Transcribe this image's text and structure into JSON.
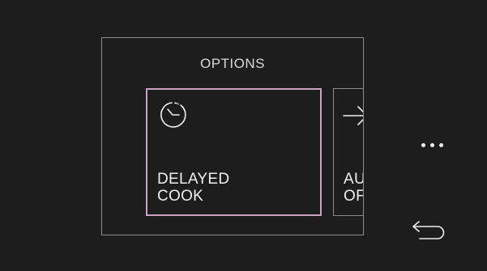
{
  "options": {
    "title": "OPTIONS",
    "cards": [
      {
        "icon": "clock-icon",
        "label_line1": "DELAYED",
        "label_line2": "COOK",
        "selected": true
      },
      {
        "icon": "arrow-right-icon",
        "label_line1": "AU",
        "label_line2": "OF",
        "selected": false
      }
    ]
  },
  "controls": {
    "more_icon": "more-dots-icon",
    "back_icon": "back-arrow-icon"
  },
  "colors": {
    "background": "#1d1d1d",
    "panel_border": "#8a8a8a",
    "selected_border": "#c9a3c3",
    "text": "#f0f0f0"
  }
}
